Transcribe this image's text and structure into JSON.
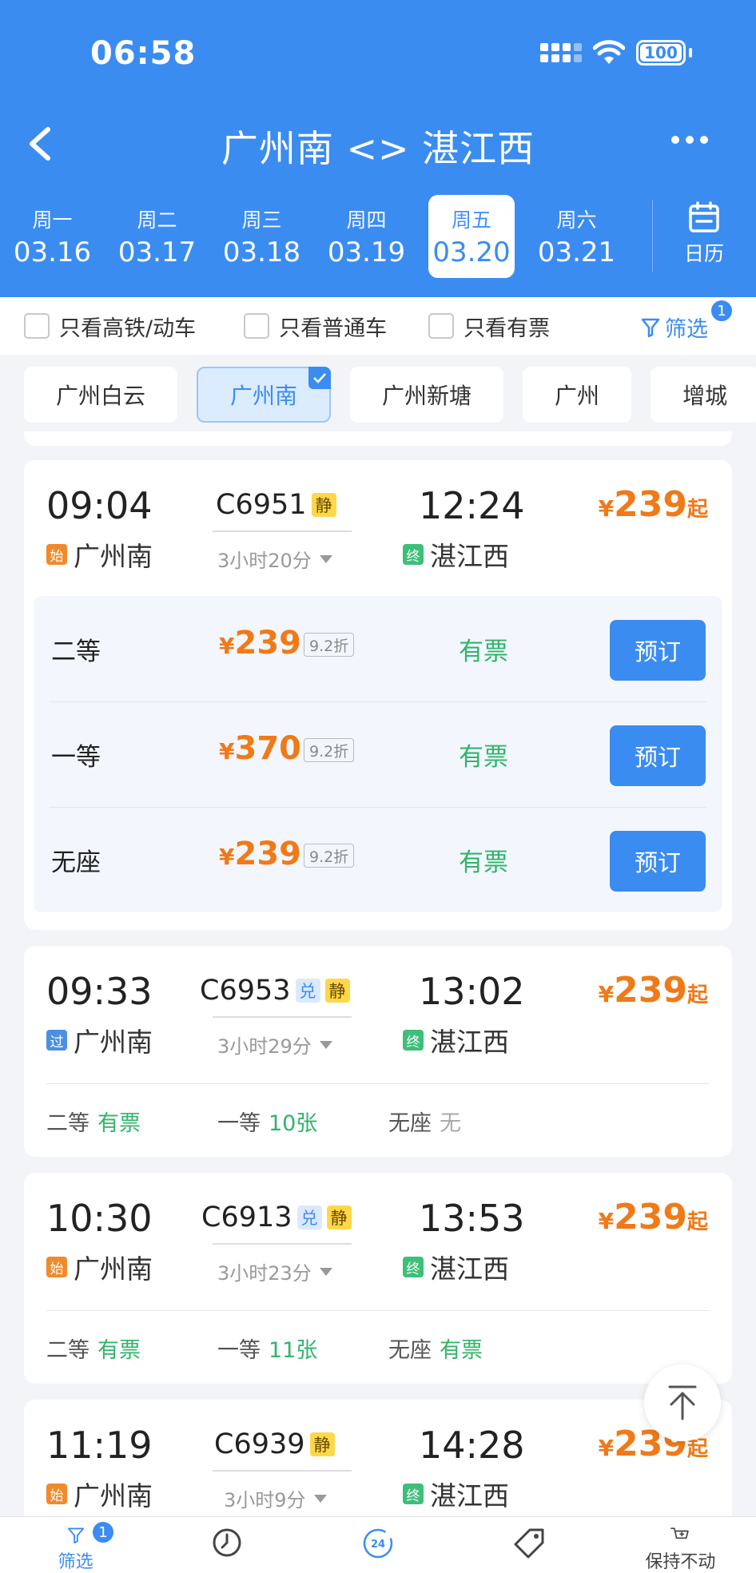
{
  "status": {
    "time": "06:58",
    "battery": "100"
  },
  "nav": {
    "title": "广州南 <> 湛江西"
  },
  "dates": [
    {
      "weekday": "周一",
      "date": "03.16",
      "active": false
    },
    {
      "weekday": "周二",
      "date": "03.17",
      "active": false
    },
    {
      "weekday": "周三",
      "date": "03.18",
      "active": false
    },
    {
      "weekday": "周四",
      "date": "03.19",
      "active": false
    },
    {
      "weekday": "周五",
      "date": "03.20",
      "active": true
    },
    {
      "weekday": "周六",
      "date": "03.21",
      "active": false
    }
  ],
  "calendar_label": "日历",
  "filters": {
    "high_speed": "只看高铁/动车",
    "normal": "只看普通车",
    "available": "只看有票",
    "filter_label": "筛选",
    "filter_count": "1"
  },
  "stations": [
    "广州白云",
    "广州南",
    "广州新塘",
    "广州",
    "增城"
  ],
  "active_station": "广州南",
  "trains": [
    {
      "dep_time": "09:04",
      "dep_station": "广州南",
      "dep_tag": "始",
      "train_no": "C6951",
      "tags": [
        "静"
      ],
      "duration": "3小时20分",
      "arr_time": "12:24",
      "arr_station": "湛江西",
      "arr_tag": "终",
      "currency": "¥",
      "price": "239",
      "price_suffix": "起",
      "seats": [
        {
          "name": "二等",
          "price": "239",
          "discount": "9.2折",
          "status": "有票",
          "action": "预订"
        },
        {
          "name": "一等",
          "price": "370",
          "discount": "9.2折",
          "status": "有票",
          "action": "预订"
        },
        {
          "name": "无座",
          "price": "239",
          "discount": "9.2折",
          "status": "有票",
          "action": "预订"
        }
      ]
    },
    {
      "dep_time": "09:33",
      "dep_station": "广州南",
      "dep_tag": "过",
      "train_no": "C6953",
      "tags": [
        "兑",
        "静"
      ],
      "duration": "3小时29分",
      "arr_time": "13:02",
      "arr_station": "湛江西",
      "arr_tag": "终",
      "currency": "¥",
      "price": "239",
      "price_suffix": "起",
      "summary": [
        {
          "name": "二等",
          "value": "有票"
        },
        {
          "name": "一等",
          "value": "10张"
        },
        {
          "name": "无座",
          "value": "无"
        }
      ]
    },
    {
      "dep_time": "10:30",
      "dep_station": "广州南",
      "dep_tag": "始",
      "train_no": "C6913",
      "tags": [
        "兑",
        "静"
      ],
      "duration": "3小时23分",
      "arr_time": "13:53",
      "arr_station": "湛江西",
      "arr_tag": "终",
      "currency": "¥",
      "price": "239",
      "price_suffix": "起",
      "summary": [
        {
          "name": "二等",
          "value": "有票"
        },
        {
          "name": "一等",
          "value": "11张"
        },
        {
          "name": "无座",
          "value": "有票"
        }
      ]
    },
    {
      "dep_time": "11:19",
      "dep_station": "广州南",
      "dep_tag": "始",
      "train_no": "C6939",
      "tags": [
        "静"
      ],
      "duration": "3小时9分",
      "arr_time": "14:28",
      "arr_station": "湛江西",
      "arr_tag": "终",
      "currency": "¥",
      "price": "239",
      "price_suffix": "起"
    }
  ],
  "tabbar": {
    "filter_label": "筛选",
    "filter_badge": "1",
    "clock_24": "24",
    "last_label": "保持不动"
  },
  "colors": {
    "brand": "#3b8cf0",
    "price": "#f07a18",
    "available": "#2fb56a"
  }
}
